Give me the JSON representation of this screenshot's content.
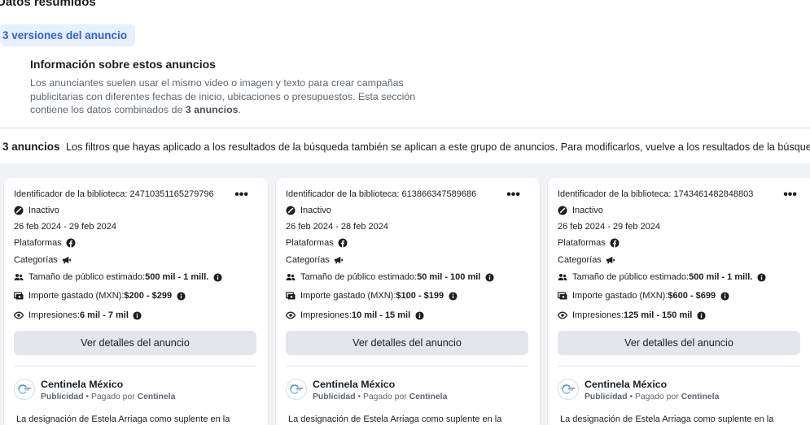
{
  "section": {
    "title": "Datos resumidos"
  },
  "versions": {
    "label": "3 versiones del anuncio"
  },
  "info": {
    "title": "Información sobre estos anuncios",
    "body_prefix": "Los anunciantes suelen usar el mismo video o imagen y texto para crear campañas publicitarias con diferentes fechas de inicio, ubicaciones o presupuestos. Esta sección contiene los datos combinados de ",
    "body_bold": "3 anuncios",
    "body_suffix": "."
  },
  "results": {
    "count": "3 anuncios",
    "note": "Los filtros que hayas aplicado a los resultados de la búsqueda también se aplican a este grupo de anuncios. Para modificarlos, vuelve a los resultados de la búsqueda"
  },
  "cards": [
    {
      "library_id": "Identificador de la biblioteca: 24710351165279796",
      "status": "Inactivo",
      "dates": "26 feb 2024 - 29 feb 2024",
      "platforms_label": "Plataformas",
      "categories_label": "Categorías",
      "audience_label": "Tamaño de público estimado: ",
      "audience_value": "500 mil - 1 mill.",
      "spend_label": "Importe gastado (MXN): ",
      "spend_value": "$200 - $299",
      "impressions_label": "Impresiones: ",
      "impressions_value": "6 mil - 7 mil",
      "more": "•••",
      "details_button": "Ver detalles del anuncio",
      "page_name": "Centinela México",
      "sponsored": "Publicidad",
      "paid_by_prefix": " • Pagado por ",
      "paid_by": "Centinela",
      "ad_text": "La designación de Estela Arriaga como suplente en la"
    },
    {
      "library_id": "Identificador de la biblioteca: 613866347589686",
      "status": "Inactivo",
      "dates": "26 feb 2024 - 28 feb 2024",
      "platforms_label": "Plataformas",
      "categories_label": "Categorías",
      "audience_label": "Tamaño de público estimado: ",
      "audience_value": "50 mil - 100 mil",
      "spend_label": "Importe gastado (MXN): ",
      "spend_value": "$100 - $199",
      "impressions_label": "Impresiones: ",
      "impressions_value": "10 mil - 15 mil",
      "more": "•••",
      "details_button": "Ver detalles del anuncio",
      "page_name": "Centinela México",
      "sponsored": "Publicidad",
      "paid_by_prefix": " • Pagado por ",
      "paid_by": "Centinela",
      "ad_text": "La designación de Estela Arriaga como suplente en la"
    },
    {
      "library_id": "Identificador de la biblioteca: 1743461482848803",
      "status": "Inactivo",
      "dates": "26 feb 2024 - 29 feb 2024",
      "platforms_label": "Plataformas",
      "categories_label": "Categorías",
      "audience_label": "Tamaño de público estimado: ",
      "audience_value": "500 mil - 1 mill.",
      "spend_label": "Importe gastado (MXN): ",
      "spend_value": "$600 - $699",
      "impressions_label": "Impresiones: ",
      "impressions_value": "125 mil - 150 mil",
      "more": "•••",
      "details_button": "Ver detalles del anuncio",
      "page_name": "Centinela México",
      "sponsored": "Publicidad",
      "paid_by_prefix": " • Pagado por ",
      "paid_by": "Centinela",
      "ad_text": "La designación de Estela Arriaga como suplente en la"
    }
  ],
  "icons": {
    "status": "inactive-status-icon",
    "platform": "facebook-icon",
    "category": "megaphone-icon",
    "audience": "people-icon",
    "spend": "money-icon",
    "impressions": "eye-icon",
    "info": "info-icon"
  },
  "colors": {
    "accent": "#2b62d9",
    "pill_bg": "#e7f0fd",
    "gray_bg": "#f0f2f5",
    "button_bg": "#e4e6eb",
    "muted_text": "#606770"
  }
}
